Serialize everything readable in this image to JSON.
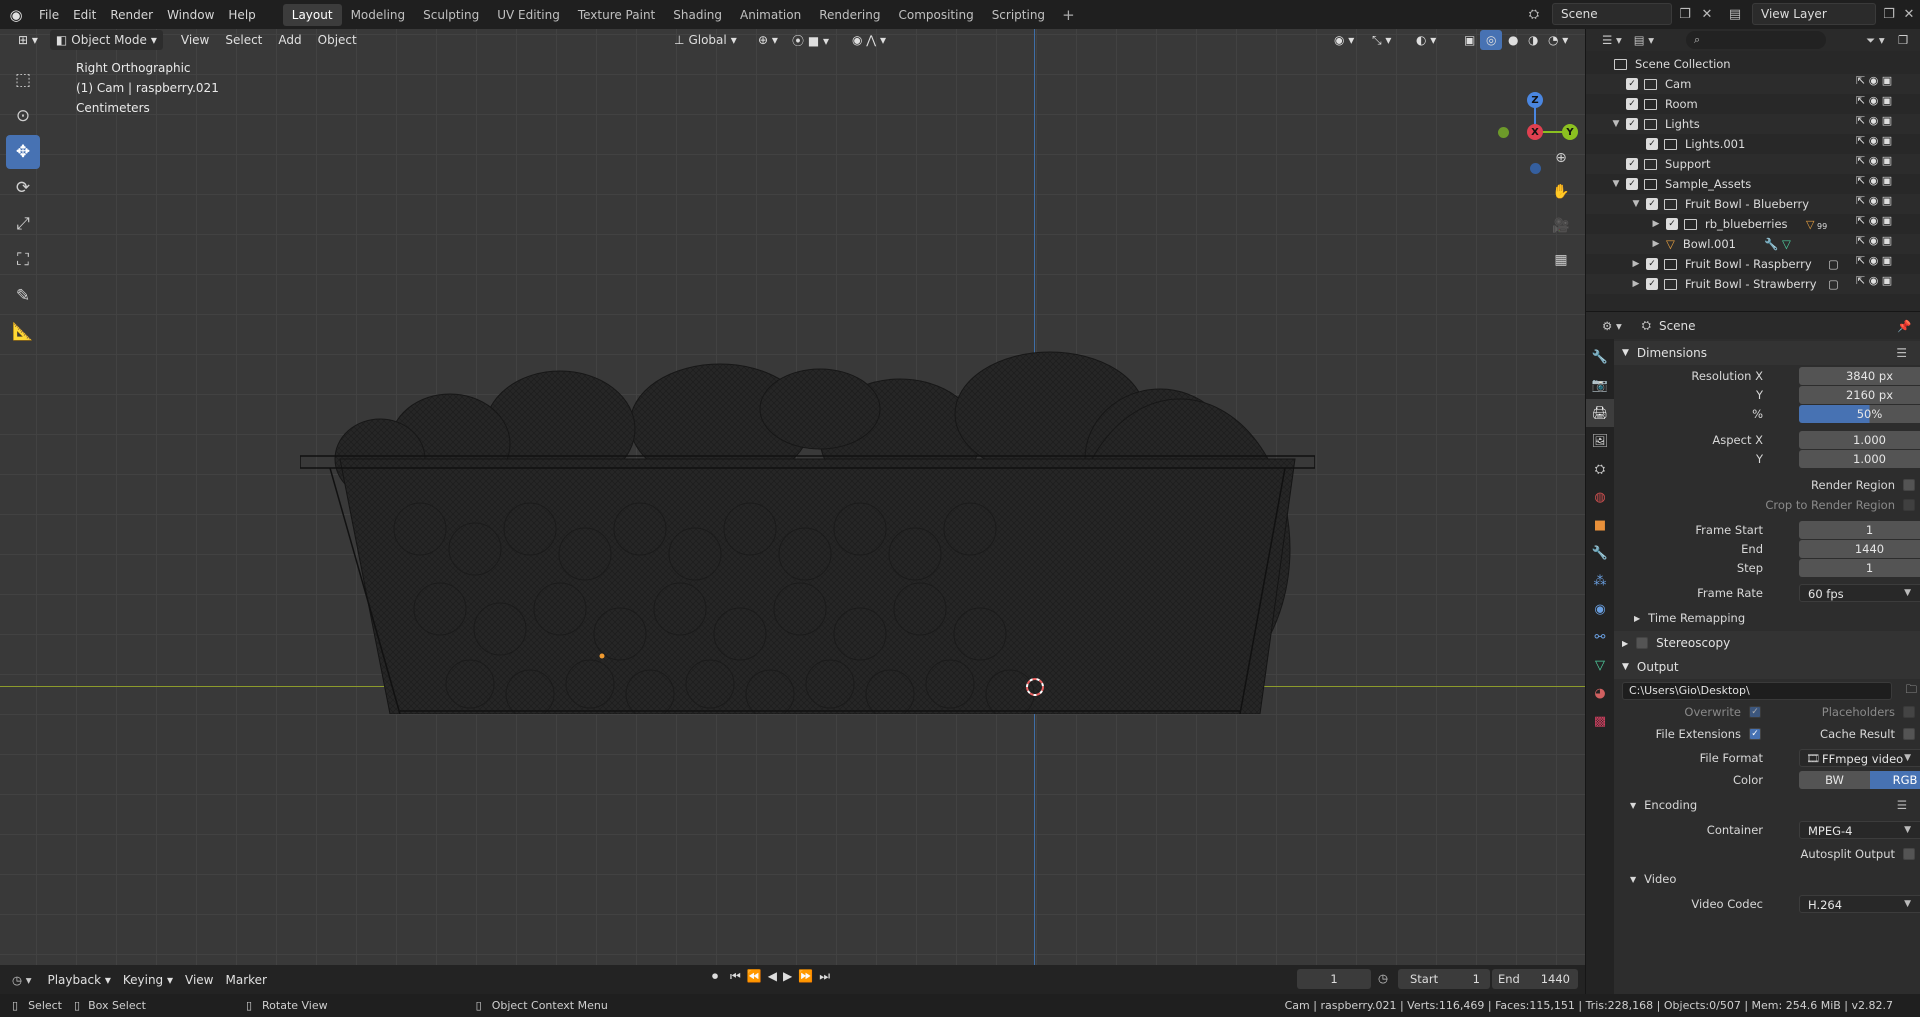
{
  "topbar": {
    "menus": [
      "File",
      "Edit",
      "Render",
      "Window",
      "Help"
    ],
    "workspaces": [
      "Layout",
      "Modeling",
      "Sculpting",
      "UV Editing",
      "Texture Paint",
      "Shading",
      "Animation",
      "Rendering",
      "Compositing",
      "Scripting"
    ],
    "active_workspace": "Layout",
    "add_tab": "+",
    "scene": "Scene",
    "view_layer": "View Layer"
  },
  "viewport": {
    "mode": "Object Mode",
    "menus": [
      "View",
      "Select",
      "Add",
      "Object"
    ],
    "transform_orientation": "Global",
    "overlay_line1": "Right Orthographic",
    "overlay_line2": "(1) Cam | raspberry.021",
    "overlay_line3": "Centimeters",
    "gizmo_z": "Z",
    "gizmo_x": "X",
    "gizmo_y": "Y",
    "colors": {
      "x_axis": "#e04050",
      "y_axis": "#8bc020",
      "z_axis": "#4a86e0",
      "active": "#4772b3"
    }
  },
  "outliner": {
    "search_placeholder": "",
    "root": "Scene Collection",
    "items": [
      {
        "label": "Cam"
      },
      {
        "label": "Room"
      },
      {
        "label": "Lights"
      },
      {
        "label": "Lights.001"
      },
      {
        "label": "Support"
      },
      {
        "label": "Sample_Assets"
      },
      {
        "label": "Fruit Bowl - Blueberry"
      },
      {
        "label": "rb_blueberries",
        "badge": "99"
      },
      {
        "label": "Bowl.001"
      },
      {
        "label": "Fruit Bowl - Raspberry"
      },
      {
        "label": "Fruit Bowl - Strawberry"
      }
    ]
  },
  "properties": {
    "context": "Scene",
    "dimensions": {
      "title": "Dimensions",
      "res_x_label": "Resolution X",
      "res_x": "3840 px",
      "res_y_label": "Y",
      "res_y": "2160 px",
      "pct_label": "%",
      "pct": "50%",
      "pct_fraction": 0.5,
      "aspect_x_label": "Aspect X",
      "aspect_x": "1.000",
      "aspect_y_label": "Y",
      "aspect_y": "1.000",
      "render_region": "Render Region",
      "crop_region": "Crop to Render Region",
      "frame_start_label": "Frame Start",
      "frame_start": "1",
      "end_label": "End",
      "end": "1440",
      "step_label": "Step",
      "step": "1",
      "frame_rate_label": "Frame Rate",
      "frame_rate": "60 fps",
      "time_remapping": "Time Remapping"
    },
    "stereoscopy": "Stereoscopy",
    "output": {
      "title": "Output",
      "path": "C:\\Users\\Gio\\Desktop\\",
      "overwrite": "Overwrite",
      "placeholders": "Placeholders",
      "file_extensions": "File Extensions",
      "cache_result": "Cache Result",
      "file_format_label": "File Format",
      "file_format": "FFmpeg video",
      "color_label": "Color",
      "color_bw": "BW",
      "color_rgb": "RGB"
    },
    "encoding": {
      "title": "Encoding",
      "container_label": "Container",
      "container": "MPEG-4",
      "autosplit": "Autosplit Output"
    },
    "video": {
      "title": "Video",
      "codec_label": "Video Codec",
      "codec": "H.264"
    }
  },
  "timeline": {
    "menus": [
      "Playback",
      "Keying",
      "View",
      "Marker"
    ],
    "current_frame": "1",
    "start_label": "Start",
    "start": "1",
    "end_label": "End",
    "end": "1440"
  },
  "statusbar": {
    "select": "Select",
    "box_select": "Box Select",
    "rotate_view": "Rotate View",
    "context_menu": "Object Context Menu",
    "stats": "Cam | raspberry.021 | Verts:116,469 | Faces:115,151 | Tris:228,168 | Objects:0/507 | Mem: 254.6 MiB | v2.82.7"
  }
}
